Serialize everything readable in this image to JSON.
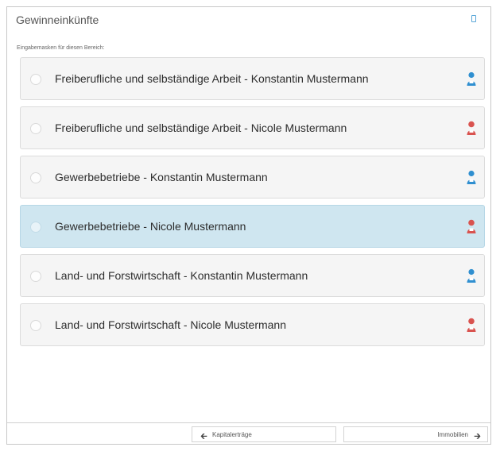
{
  "page": {
    "title": "Gewinneinkünfte",
    "subtitle": "Eingabemasken für diesen Bereich:"
  },
  "colors": {
    "male_icon": "#2f8fd0",
    "female_icon": "#d9534f",
    "selected_row": "#cfe6f0"
  },
  "items": [
    {
      "label": "Freiberufliche und selbständige Arbeit - Konstantin Mustermann",
      "person": "male-person-icon",
      "selected": false
    },
    {
      "label": "Freiberufliche und selbständige Arbeit - Nicole Mustermann",
      "person": "female-person-icon",
      "selected": false
    },
    {
      "label": "Gewerbebetriebe - Konstantin Mustermann",
      "person": "male-person-icon",
      "selected": false
    },
    {
      "label": "Gewerbebetriebe - Nicole Mustermann",
      "person": "female-person-icon",
      "selected": true
    },
    {
      "label": "Land- und Forstwirtschaft - Konstantin Mustermann",
      "person": "male-person-icon",
      "selected": false
    },
    {
      "label": "Land- und Forstwirtschaft - Nicole Mustermann",
      "person": "female-person-icon",
      "selected": false
    }
  ],
  "footer": {
    "prev_label": "Kapitalerträge",
    "next_label": "Immobilien"
  }
}
